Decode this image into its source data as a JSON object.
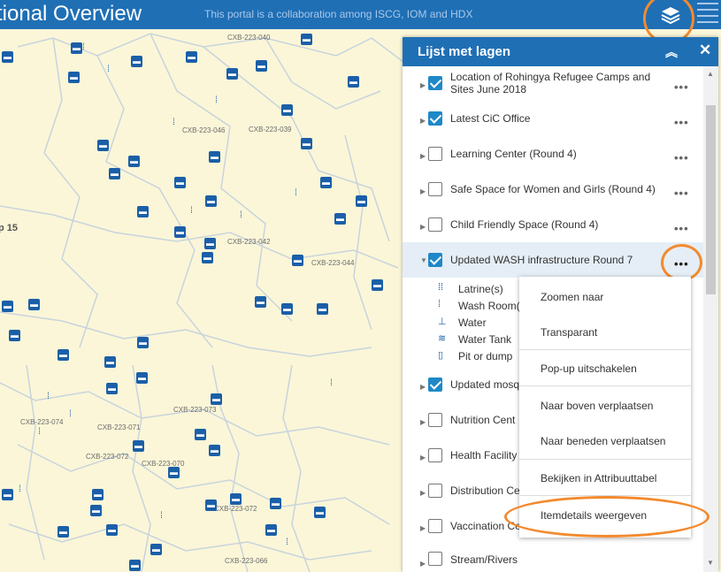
{
  "header": {
    "title": "tional Overview",
    "subtitle": "This portal is a collaboration among ISCG, IOM and HDX",
    "layers_icon": "layers-icon",
    "menu_icon": "menu-icon"
  },
  "map": {
    "labels": [
      "CXB-223-040",
      "CXB-223-046",
      "CXB-223-039",
      "CXB-223-042",
      "CXB-223-044",
      "CXB-223-073",
      "CXB-223-074",
      "CXB-223-071",
      "CXB-223-072",
      "CXB-223-070",
      "CXB-223-072",
      "CXB-223-066",
      "p 15"
    ]
  },
  "panel": {
    "title": "Lijst met lagen",
    "collapse_icon": "double-chevron-up-icon",
    "close_icon": "close-icon",
    "layers": [
      {
        "label": "Location of Rohingya Refugee Camps and Sites June 2018",
        "checked": true
      },
      {
        "label": "Latest CiC Office",
        "checked": true
      },
      {
        "label": "Learning Center (Round 4)",
        "checked": false
      },
      {
        "label": "Safe Space for Women and Girls (Round 4)",
        "checked": false
      },
      {
        "label": "Child Friendly Space (Round 4)",
        "checked": false
      },
      {
        "label": "Updated WASH infrastructure Round 7",
        "checked": true,
        "expanded": true
      },
      {
        "label": "Updated mosq",
        "checked": true
      },
      {
        "label": "Nutrition Cent",
        "checked": false
      },
      {
        "label": "Health Facility",
        "checked": false
      },
      {
        "label": "Distribution Ce",
        "checked": false
      },
      {
        "label": "Vaccination Ce",
        "checked": false
      },
      {
        "label": "Stream/Rivers",
        "checked": false
      }
    ],
    "legend": [
      {
        "label": "Latrine(s)",
        "icon": "latrine-icon"
      },
      {
        "label": "Wash Room(",
        "icon": "wash-room-icon"
      },
      {
        "label": "Water",
        "icon": "water-icon"
      },
      {
        "label": "Water Tank",
        "icon": "water-tank-icon"
      },
      {
        "label": "Pit or dump",
        "icon": "pit-icon"
      }
    ],
    "more_label": "•••"
  },
  "context_menu": {
    "items": [
      "Zoomen naar",
      "Transparant",
      "Pop-up uitschakelen",
      "Naar boven verplaatsen",
      "Naar beneden verplaatsen",
      "Bekijken in Attribuuttabel",
      "Itemdetails weergeven"
    ]
  },
  "colors": {
    "header_bg": "#1f6fb5",
    "map_bg": "#fbf6d8",
    "poi": "#1b5fa8",
    "highlight": "#f38a2e",
    "checkbox_on": "#1f88c7"
  }
}
